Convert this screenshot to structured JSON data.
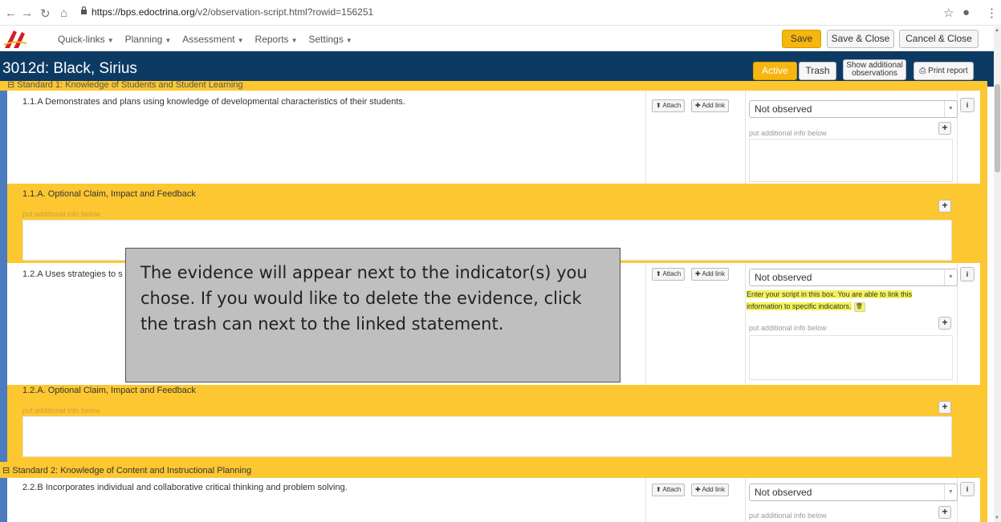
{
  "browser": {
    "url_domain": "https://bps.edoctrina.org",
    "url_path": "/v2/observation-script.html?rowid=156251"
  },
  "menu": {
    "items": [
      "Quick-links",
      "Planning",
      "Assessment",
      "Reports",
      "Settings"
    ],
    "save": "Save",
    "save_close": "Save & Close",
    "cancel_close": "Cancel & Close"
  },
  "header": {
    "title": "3012d: Black, Sirius",
    "active": "Active",
    "trash": "Trash",
    "show_additional": "Show additional observations",
    "print_report": "Print report"
  },
  "standards": [
    {
      "label": "⊟ Standard 1: Knowledge of Students and Student Learning"
    },
    {
      "label": "⊟ Standard 2: Knowledge of Content and Instructional Planning"
    }
  ],
  "indicators": [
    {
      "label": "1.1.A Demonstrates and plans using knowledge of developmental characteristics of their students.",
      "status": "Not observed"
    },
    {
      "label": "1.2.A Uses strategies to s",
      "status": "Not observed",
      "linked": "Enter your script in this box.  You are able to link this information to specific indicators."
    },
    {
      "label": "2.2.B Incorporates individual and collaborative critical thinking and problem solving.",
      "status": "Not observed"
    }
  ],
  "claims": [
    {
      "label": "1.1.A. Optional Claim, Impact and Feedback"
    },
    {
      "label": "1.2.A. Optional Claim, Impact and Feedback"
    }
  ],
  "common": {
    "attach": "Attach",
    "add_link": "Add link",
    "hint": "put additional info below",
    "info": "i",
    "plus": "+"
  },
  "callout": {
    "text": "The evidence will appear next to the indicator(s) you chose.  If you would like to delete the evidence, click the trash can next to the linked statement."
  },
  "colors": {
    "navy": "#0d3a63",
    "gold": "#fdc731",
    "save": "#f6b60f"
  }
}
